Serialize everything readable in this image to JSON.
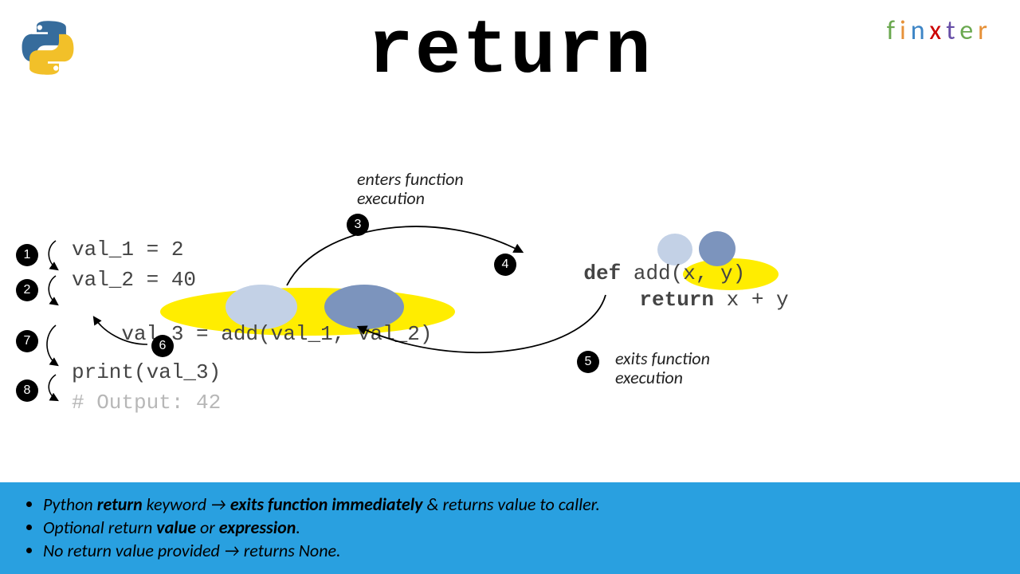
{
  "title": "return",
  "brand": {
    "f": "f",
    "i": "i",
    "n": "n",
    "x": "x",
    "t": "t",
    "e": "e",
    "r": "r"
  },
  "python_logo_alt": "python-logo",
  "code_left": {
    "l1": "val_1 = 2",
    "l2": "val_2 = 40",
    "l3_pre": "val_3 = ",
    "l3_call": "add(val_1, val_2)",
    "l4": "print(val_3)",
    "l5": "# Output: 42"
  },
  "code_right": {
    "def_kw": "def",
    "def_sig": " add(x, y)",
    "ret_kw": "return",
    "ret_expr": " x + y"
  },
  "annot": {
    "enter1": "enters function",
    "enter2": "execution",
    "exit1": "exits function",
    "exit2": "execution"
  },
  "steps": {
    "s1": "1",
    "s2": "2",
    "s3": "3",
    "s4": "4",
    "s5": "5",
    "s6": "6",
    "s7": "7",
    "s8": "8"
  },
  "footer": {
    "b1a": "Python ",
    "b1b": "return",
    "b1c": " keyword → ",
    "b1d": "exits function immediately",
    "b1e": " & returns value to caller.",
    "b2a": "Optional return ",
    "b2b": "value",
    "b2c": " or ",
    "b2d": "expression",
    "b2e": ".",
    "b3a": "No return value provided → returns None."
  }
}
